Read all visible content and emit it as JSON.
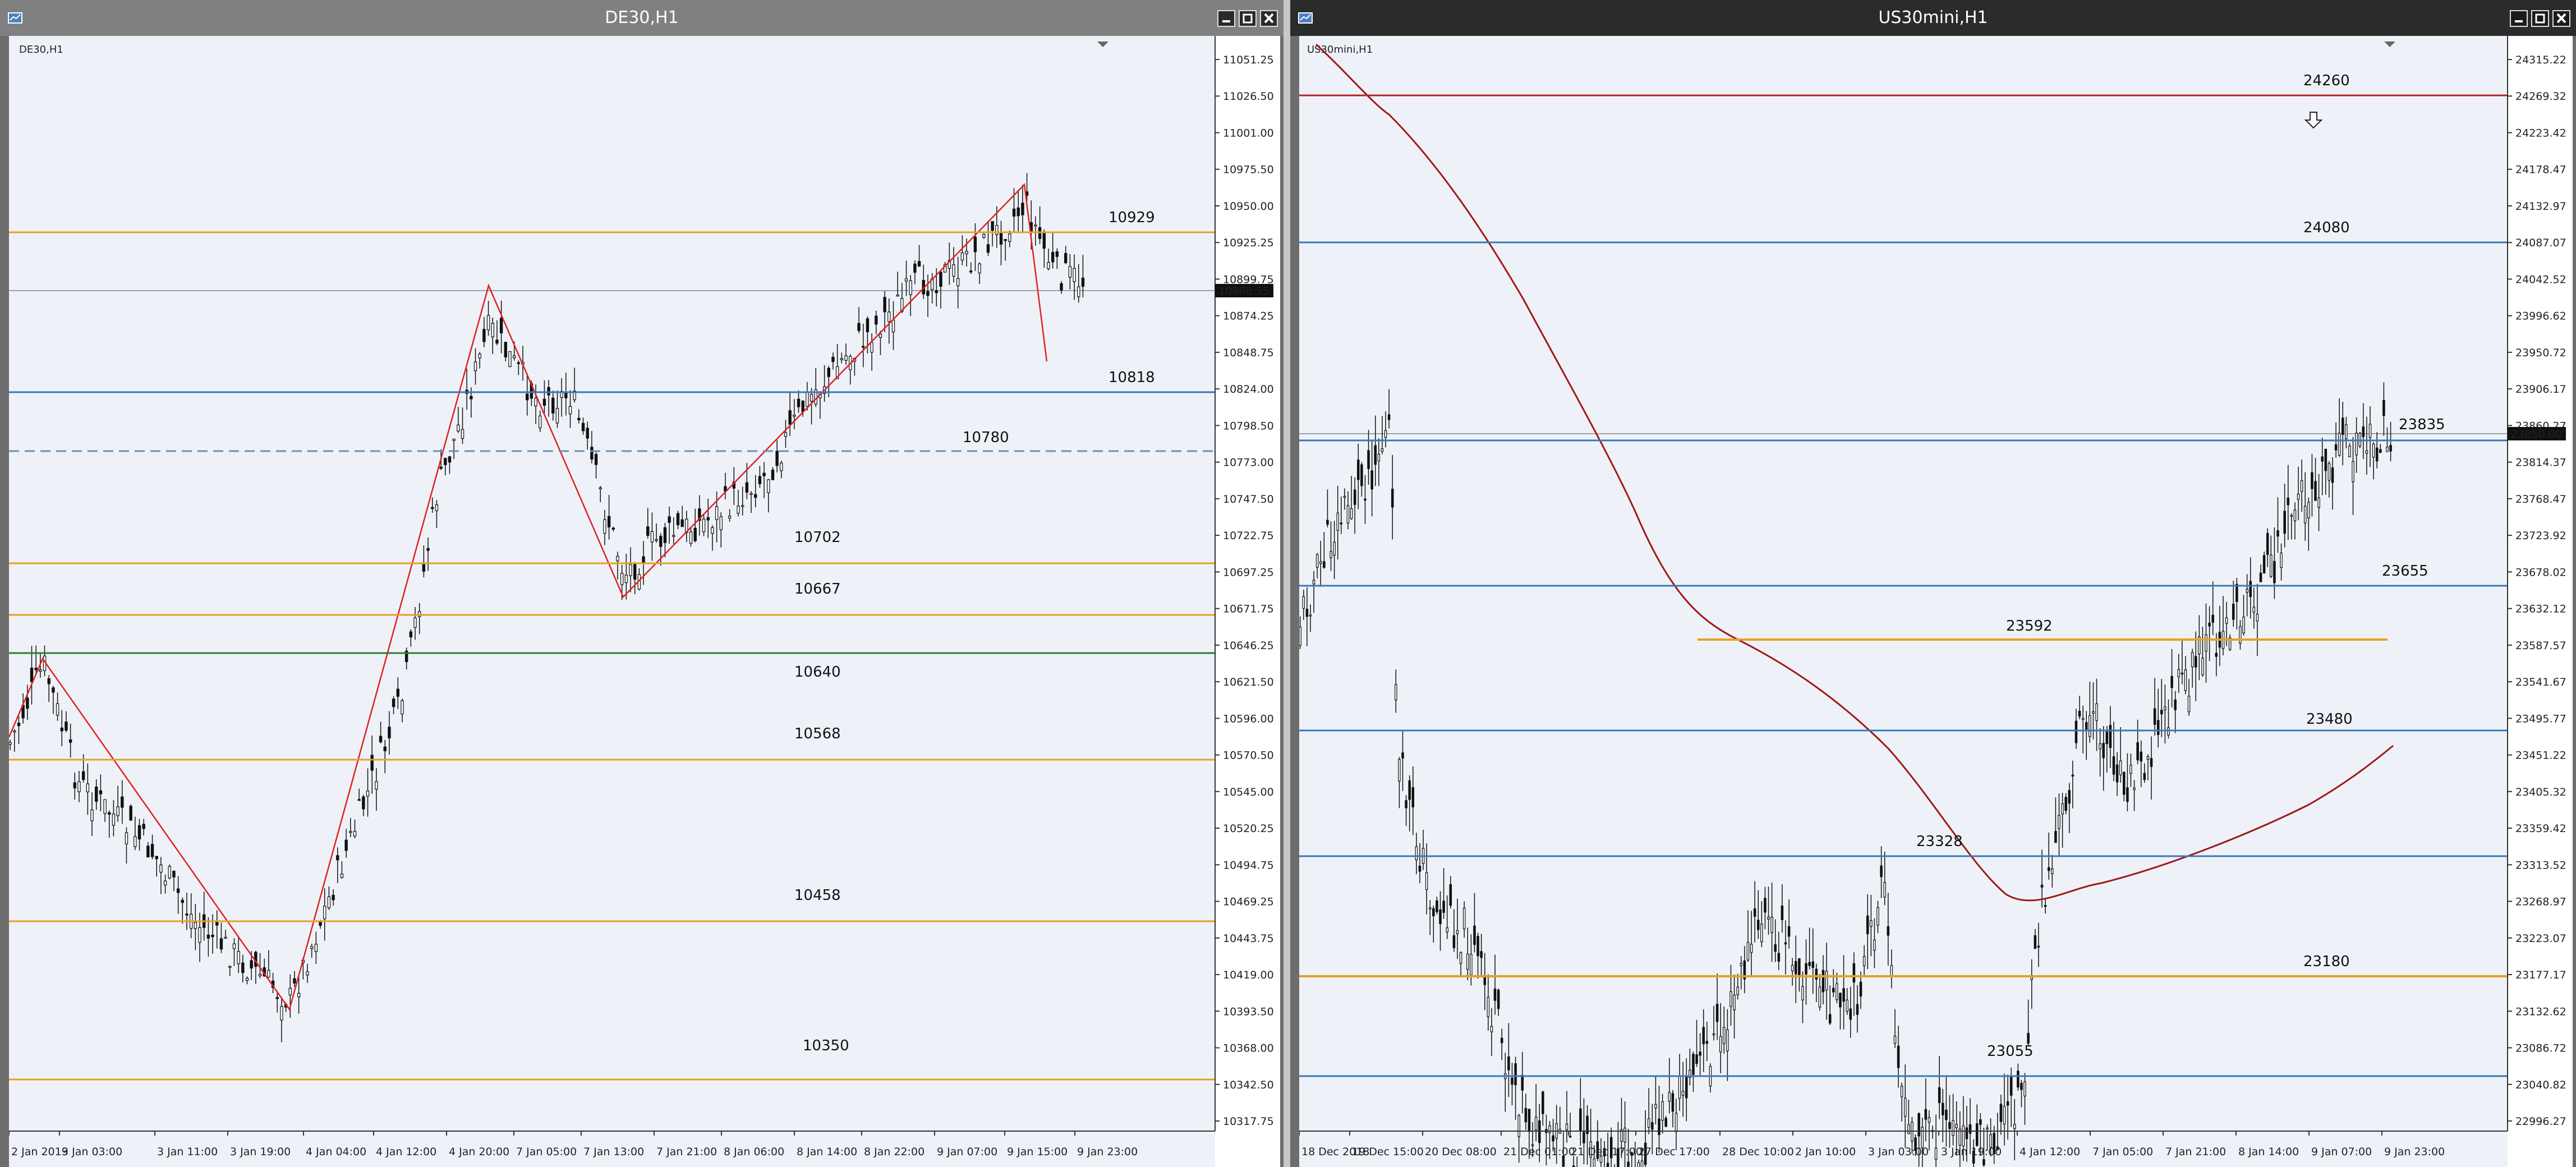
{
  "windows": [
    {
      "id": "de30",
      "title": "DE30,H1",
      "symbol_label": "DE30,H1",
      "price_labels": [
        "11051.25",
        "11026.50",
        "11001.00",
        "10975.50",
        "10950.00",
        "10925.25",
        "10899.75",
        "10874.25",
        "10848.75",
        "10824.00",
        "10798.50",
        "10773.00",
        "10747.50",
        "10722.75",
        "10697.25",
        "10671.75",
        "10646.25",
        "10621.50",
        "10596.00",
        "10570.50",
        "10545.00",
        "10520.25",
        "10494.75",
        "10469.25",
        "10443.75",
        "10419.00",
        "10393.50",
        "10368.00",
        "10342.50",
        "10317.75"
      ],
      "current_price": "10888.55",
      "time_labels": [
        "2 Jan 2019",
        "3 Jan 03:00",
        "3 Jan 11:00",
        "3 Jan 19:00",
        "4 Jan 04:00",
        "4 Jan 12:00",
        "4 Jan 20:00",
        "7 Jan 05:00",
        "7 Jan 13:00",
        "7 Jan 21:00",
        "8 Jan 06:00",
        "8 Jan 14:00",
        "8 Jan 22:00",
        "9 Jan 07:00",
        "9 Jan 15:00",
        "9 Jan 23:00"
      ],
      "levels": [
        {
          "value": "10929",
          "color": "#e8a020"
        },
        {
          "value": "10818",
          "color": "#3a78b8"
        },
        {
          "value": "10780",
          "color": "#6f8fb5",
          "dashed": true
        },
        {
          "value": "10702",
          "color": "#e8a020"
        },
        {
          "value": "10667",
          "color": "#e8a020"
        },
        {
          "value": "10640",
          "color": "#2e7d32"
        },
        {
          "value": "10568",
          "color": "#e8a020"
        },
        {
          "value": "10458",
          "color": "#e8a020"
        },
        {
          "value": "10350",
          "color": "#e8a020"
        }
      ]
    },
    {
      "id": "us30mini",
      "title": "US30mini,H1",
      "symbol_label": "US30mini,H1",
      "price_labels": [
        "24315.22",
        "24269.32",
        "24223.42",
        "24178.47",
        "24132.97",
        "24087.07",
        "24042.52",
        "23996.62",
        "23950.72",
        "23906.17",
        "23860.27",
        "23814.37",
        "23768.47",
        "23723.92",
        "23678.02",
        "23632.12",
        "23587.57",
        "23541.67",
        "23495.77",
        "23451.22",
        "23405.32",
        "23359.42",
        "23313.52",
        "23268.97",
        "23223.07",
        "23177.17",
        "23132.62",
        "23086.72",
        "23040.82",
        "22996.27"
      ],
      "current_price": "23850.00",
      "time_labels": [
        "18 Dec 2018",
        "19 Dec 15:00",
        "20 Dec 08:00",
        "21 Dec 01:00",
        "21 Dec 17:00",
        "27 Dec 17:00",
        "28 Dec 10:00",
        "2 Jan 10:00",
        "3 Jan 03:00",
        "3 Jan 19:00",
        "4 Jan 12:00",
        "7 Jan 05:00",
        "7 Jan 21:00",
        "8 Jan 14:00",
        "9 Jan 07:00",
        "9 Jan 23:00"
      ],
      "levels": [
        {
          "value": "24260",
          "color": "#b22222"
        },
        {
          "value": "24080",
          "color": "#3a78b8"
        },
        {
          "value": "23835",
          "color": "#3a78b8"
        },
        {
          "value": "23655",
          "color": "#3a78b8"
        },
        {
          "value": "23592",
          "color": "#e8a020"
        },
        {
          "value": "23480",
          "color": "#3a78b8"
        },
        {
          "value": "23328",
          "color": "#3a78b8"
        },
        {
          "value": "23180",
          "color": "#e8a020"
        },
        {
          "value": "23055",
          "color": "#3a78b8"
        }
      ]
    }
  ],
  "colors": {
    "zigzag": "#e02020",
    "moving_average": "#a01818",
    "candle": "#111111",
    "background": "#eef2f8"
  },
  "icons": {
    "arrow_marker": "down-arrow-icon",
    "window_buttons": [
      "minimize-icon",
      "maximize-icon",
      "close-icon"
    ]
  }
}
